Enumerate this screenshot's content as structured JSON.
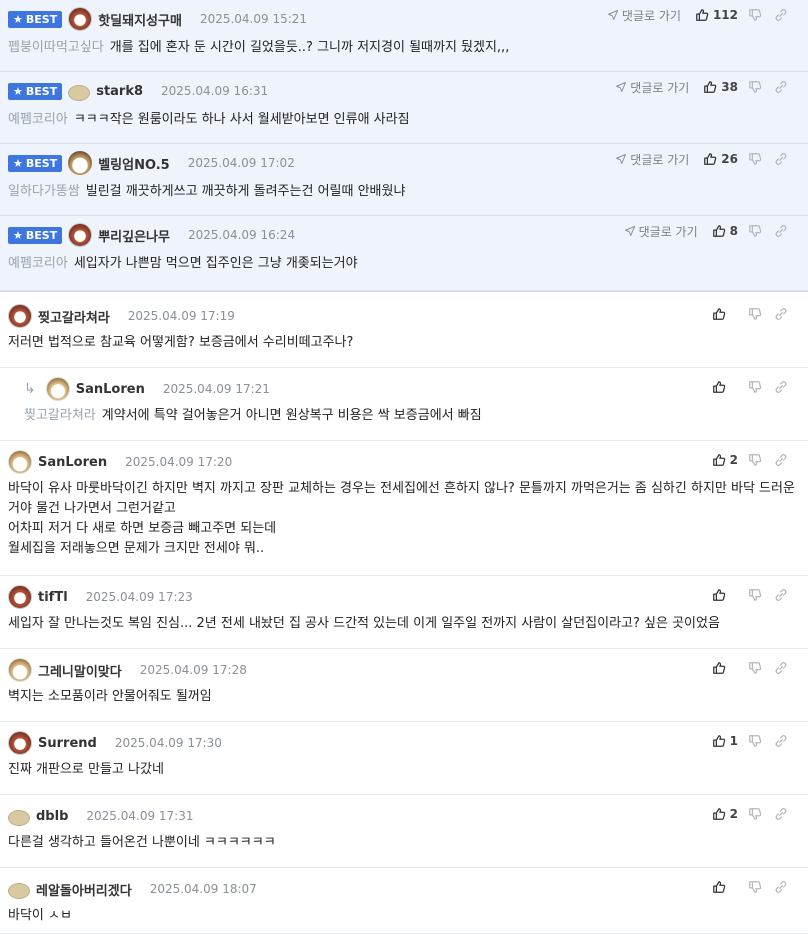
{
  "best_label": "BEST",
  "reply_link": "댓글로 가기",
  "best_comments": [
    {
      "nick": "핫딜돼지성구매",
      "date": "2025.04.09 15:21",
      "ref": "펩붕이따먹고싶다",
      "text": "개를 집에 혼자 둔 시간이 길었을듯..? 그니까 저지경이 될때까지 뒀겠지,,,",
      "likes": "112",
      "avatar": "dog-icon"
    },
    {
      "nick": "stark8",
      "date": "2025.04.09 16:31",
      "ref": "예펨코리아",
      "text": "ㅋㅋㅋ작은 원룸이라도 하나 사서 월세받아보면 인류애 사라짐",
      "likes": "38",
      "avatar": "sand-icon"
    },
    {
      "nick": "벨링엄NO.5",
      "date": "2025.04.09 17:02",
      "ref": "일하다가똥쌈",
      "text": "빌린걸 깨끗하게쓰고 깨끗하게 돌려주는건 어릴때 안배웠냐",
      "likes": "26",
      "avatar": "puppy-icon"
    },
    {
      "nick": "뿌리깊은나무",
      "date": "2025.04.09 16:24",
      "ref": "예펨코리아",
      "text": "세입자가 나쁜맘 먹으면 집주인은 그냥 개좆되는거야",
      "likes": "8",
      "avatar": "dog-icon"
    }
  ],
  "comments": [
    {
      "nick": "찢고갈라쳐라",
      "date": "2025.04.09 17:19",
      "ref": "",
      "lines": [
        "저러면 법적으로 참교육 어떻게함? 보증금에서 수리비떼고주나?"
      ],
      "likes": "",
      "avatar": "dog-icon",
      "reply": false
    },
    {
      "nick": "SanLoren",
      "date": "2025.04.09 17:21",
      "ref": "찢고갈라쳐라",
      "lines": [
        "계약서에 특약 걸어놓은거 아니면 원상복구 비용은 싹 보증금에서 빠짐"
      ],
      "likes": "",
      "avatar": "fox-icon",
      "reply": true
    },
    {
      "nick": "SanLoren",
      "date": "2025.04.09 17:20",
      "ref": "",
      "lines": [
        "바닥이 유사 마룻바닥이긴 하지만 벽지 까지고 장판 교체하는 경우는 전세집에선 흔하지 않나? 문틀까지 까먹은거는 좀 심하긴 하지만 바닥 드러운거야 물건 나가면서 그런거같고",
        "어차피 저거 다 새로 하면 보증금 빼고주면 되는데",
        "월세집을 저래놓으면 문제가 크지만 전세야 뭐.."
      ],
      "likes": "2",
      "avatar": "fox-icon",
      "reply": false
    },
    {
      "nick": "tifTl",
      "date": "2025.04.09 17:23",
      "ref": "",
      "lines": [
        "세입자 잘 만나는것도 복임 진심... 2년 전세 내놨던 집 공사 드간적 있는데 이게 일주일 전까지 사람이 살던집이라고? 싶은 곳이었음"
      ],
      "likes": "",
      "avatar": "dog-icon",
      "reply": false
    },
    {
      "nick": "그레니말이맞다",
      "date": "2025.04.09 17:28",
      "ref": "",
      "lines": [
        "벽지는 소모품이라 안물어줘도 될꺼임"
      ],
      "likes": "",
      "avatar": "fox-icon",
      "reply": false
    },
    {
      "nick": "Surrend",
      "date": "2025.04.09 17:30",
      "ref": "",
      "lines": [
        "진짜 개판으로 만들고 나갔네"
      ],
      "likes": "1",
      "avatar": "dog-icon",
      "reply": false
    },
    {
      "nick": "dblb",
      "date": "2025.04.09 17:31",
      "ref": "",
      "lines": [
        "다른걸 생각하고 들어온건 나뿐이네 ㅋㅋㅋㅋㅋㅋ"
      ],
      "likes": "2",
      "avatar": "sand-icon",
      "reply": false
    },
    {
      "nick": "레알돌아버리겠다",
      "date": "2025.04.09 18:07",
      "ref": "",
      "lines": [
        "바닥이 ㅅㅂ"
      ],
      "likes": "",
      "avatar": "sand-icon",
      "reply": false
    }
  ]
}
